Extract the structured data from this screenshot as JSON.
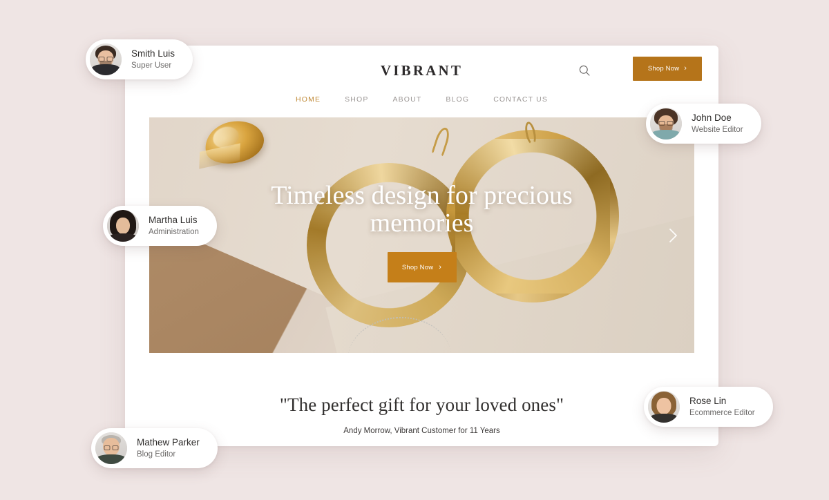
{
  "page": {
    "background_color": "#efe5e4"
  },
  "site": {
    "brand": "VIBRANT",
    "accent_color": "#b5741a",
    "header": {
      "search_icon": "search-icon",
      "shop_now_label": "Shop Now",
      "shop_now_chevron": "›"
    },
    "nav": [
      {
        "label": "HOME",
        "active": true
      },
      {
        "label": "SHOP",
        "active": false
      },
      {
        "label": "ABOUT",
        "active": false
      },
      {
        "label": "BLOG",
        "active": false
      },
      {
        "label": "CONTACT US",
        "active": false
      }
    ],
    "hero": {
      "title": "Timeless design for precious memories",
      "cta_label": "Shop Now",
      "cta_chevron": "›",
      "next_arrow_icon": "chevron-right-icon",
      "image_description": "gold hoop earrings and gemstone ring on beige paper"
    },
    "testimonial": {
      "quote": "\"The perfect gift for your loved ones\"",
      "author": "Andy Morrow, Vibrant Customer for 11 Years"
    }
  },
  "people": [
    {
      "name": "Smith Luis",
      "role": "Super User"
    },
    {
      "name": "John Doe",
      "role": "Website Editor"
    },
    {
      "name": "Martha Luis",
      "role": "Administration"
    },
    {
      "name": "Rose Lin",
      "role": "Ecommerce Editor"
    },
    {
      "name": "Mathew Parker",
      "role": "Blog Editor"
    }
  ]
}
